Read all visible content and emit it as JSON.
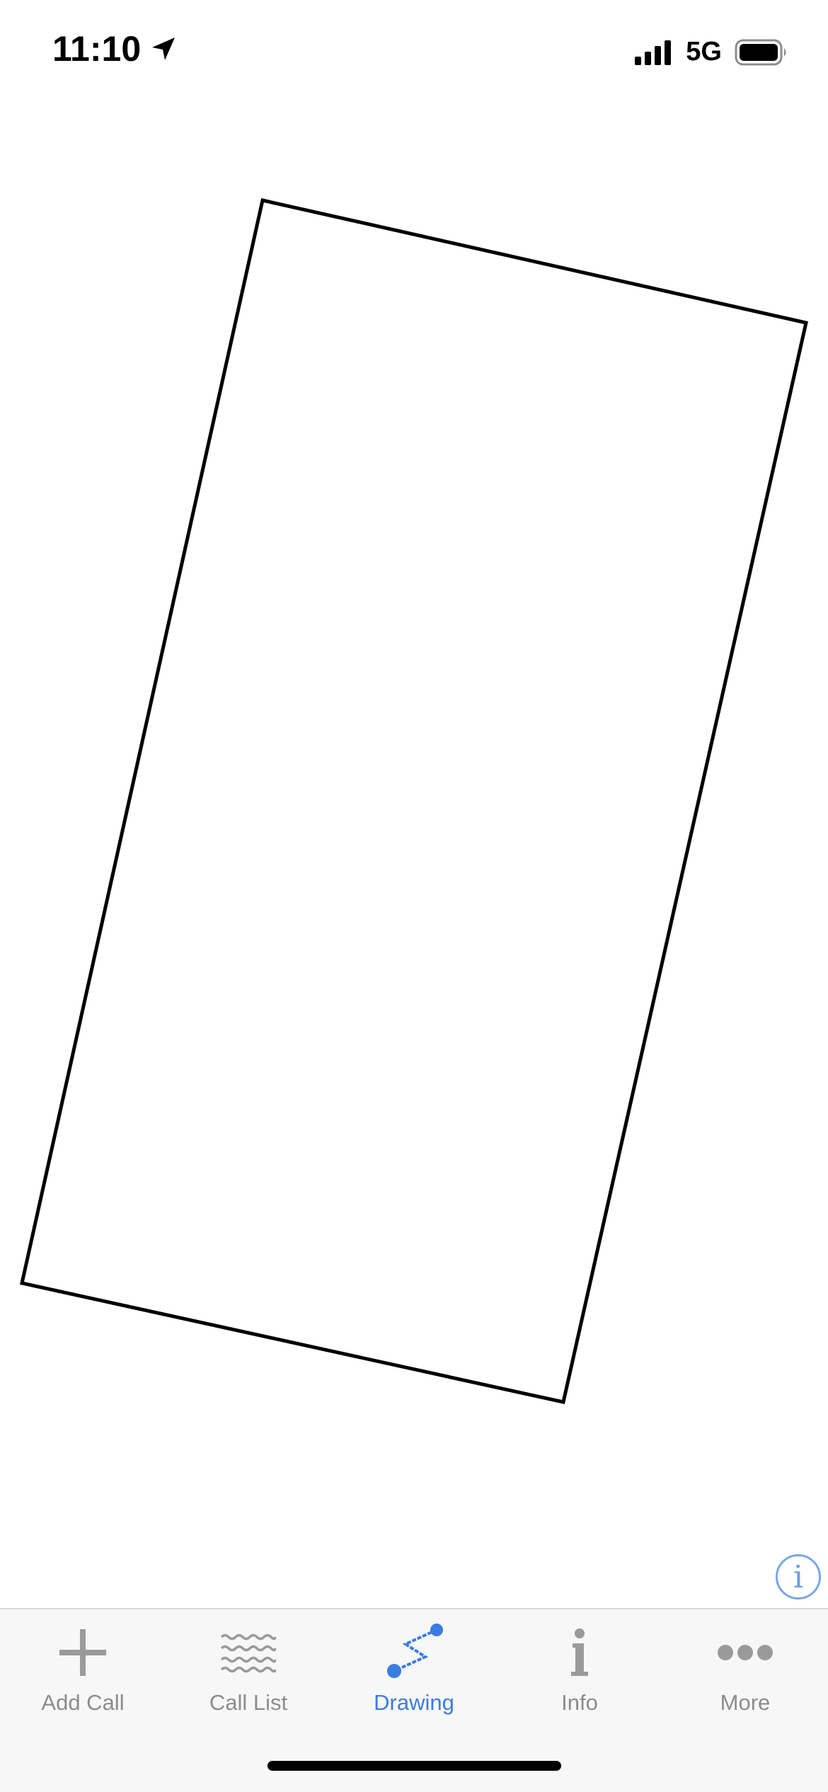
{
  "status_bar": {
    "time": "11:10",
    "location_icon": "location-arrow-icon",
    "signal_icon": "cellular-signal-icon",
    "network": "5G",
    "battery_icon": "battery-icon"
  },
  "canvas": {
    "shape": "rotated-rectangle-outline",
    "stroke_color": "#000000"
  },
  "info_button": {
    "icon": "info-circle-icon",
    "glyph": "i",
    "color": "#6d9de3"
  },
  "tab_bar": {
    "active_color": "#3a7de0",
    "inactive_color": "#8c8c8c",
    "tabs": [
      {
        "label": "Add Call",
        "icon": "plus-icon",
        "active": false
      },
      {
        "label": "Call List",
        "icon": "wavy-lines-icon",
        "active": false
      },
      {
        "label": "Drawing",
        "icon": "drawing-path-icon",
        "active": true
      },
      {
        "label": "Info",
        "icon": "info-icon",
        "active": false
      },
      {
        "label": "More",
        "icon": "ellipsis-icon",
        "active": false
      }
    ]
  }
}
